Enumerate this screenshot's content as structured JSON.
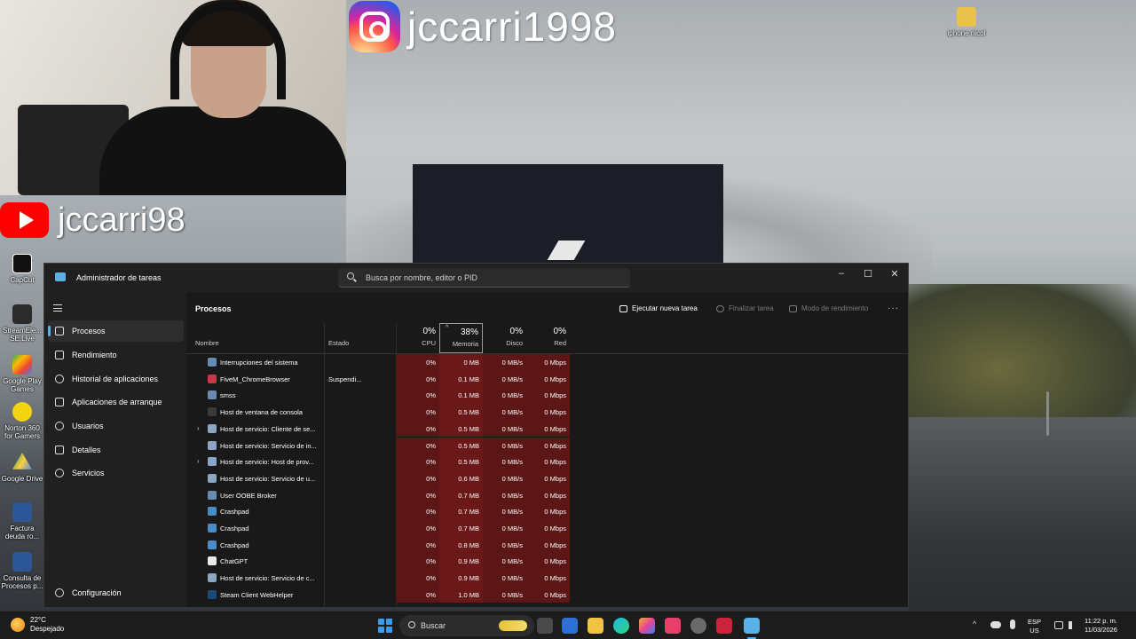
{
  "overlay": {
    "instagram_handle": "jccarri1998",
    "youtube_handle": "jccarri98"
  },
  "desktop_icons": [
    {
      "label": "iphone nicol",
      "name": "desktop-icon-iphone-nicol"
    },
    {
      "label": "CapCut",
      "name": "desktop-icon-capcut"
    },
    {
      "label": "StreamEle... SE.Live",
      "name": "desktop-icon-streamelements"
    },
    {
      "label": "Google Play Games",
      "name": "desktop-icon-google-play-games"
    },
    {
      "label": "Norton 360 for Gamers",
      "name": "desktop-icon-norton"
    },
    {
      "label": "Google Drive",
      "name": "desktop-icon-google-drive"
    },
    {
      "label": "Factura deuda ro...",
      "name": "desktop-icon-factura"
    },
    {
      "label": "Consulta de Procesos p...",
      "name": "desktop-icon-consulta"
    }
  ],
  "window": {
    "title": "Administrador de tareas",
    "search_placeholder": "Busca por nombre, editor o PID",
    "minimize": "–",
    "maximize": "☐",
    "close": "✕"
  },
  "sidebar": {
    "items": [
      {
        "label": "Procesos",
        "active": true
      },
      {
        "label": "Rendimiento"
      },
      {
        "label": "Historial de aplicaciones"
      },
      {
        "label": "Aplicaciones de arranque"
      },
      {
        "label": "Usuarios"
      },
      {
        "label": "Detalles"
      },
      {
        "label": "Servicios"
      }
    ],
    "settings_label": "Configuración"
  },
  "main": {
    "title": "Procesos",
    "commands": {
      "new_task": "Ejecutar nueva tarea",
      "end_task": "Finalizar tarea",
      "efficiency": "Modo de rendimiento",
      "more": "···"
    },
    "columns": {
      "name": "Nombre",
      "status": "Estado",
      "cpu_pct": "0%",
      "cpu_label": "CPU",
      "mem_pct": "38%",
      "mem_label": "Memoria",
      "disk_pct": "0%",
      "disk_label": "Disco",
      "net_pct": "0%",
      "net_label": "Red",
      "sort_indicator": "^"
    },
    "processes": [
      {
        "name": "Interrupciones del sistema",
        "status": "",
        "cpu": "0%",
        "mem": "0 MB",
        "disk": "0 MB/s",
        "net": "0 Mbps",
        "expand": false,
        "icon": "system-icon",
        "color": "#6a8bb0"
      },
      {
        "name": "FiveM_ChromeBrowser",
        "status": "Suspendi...",
        "cpu": "0%",
        "mem": "0.1 MB",
        "disk": "0 MB/s",
        "net": "0 Mbps",
        "expand": false,
        "icon": "fivem-icon",
        "color": "#d0334a"
      },
      {
        "name": "smss",
        "status": "",
        "cpu": "0%",
        "mem": "0.1 MB",
        "disk": "0 MB/s",
        "net": "0 Mbps",
        "expand": false,
        "icon": "system-icon",
        "color": "#6a8bb0"
      },
      {
        "name": "Host de ventana de consola",
        "status": "",
        "cpu": "0%",
        "mem": "0.5 MB",
        "disk": "0 MB/s",
        "net": "0 Mbps",
        "expand": false,
        "icon": "console-icon",
        "color": "#3a3a3a"
      },
      {
        "name": "Host de servicio: Cliente de se...",
        "status": "",
        "cpu": "0%",
        "mem": "0.5 MB",
        "disk": "0 MB/s",
        "net": "0 Mbps",
        "expand": true,
        "icon": "service-icon",
        "color": "#8ba6c4"
      },
      {
        "name": "Host de servicio: Servicio de in...",
        "status": "",
        "cpu": "0%",
        "mem": "0.5 MB",
        "disk": "0 MB/s",
        "net": "0 Mbps",
        "expand": false,
        "icon": "service-icon",
        "color": "#8ba6c4"
      },
      {
        "name": "Host de servicio: Host de prov...",
        "status": "",
        "cpu": "0%",
        "mem": "0.5 MB",
        "disk": "0 MB/s",
        "net": "0 Mbps",
        "expand": true,
        "icon": "service-icon",
        "color": "#8ba6c4"
      },
      {
        "name": "Host de servicio: Servicio de u...",
        "status": "",
        "cpu": "0%",
        "mem": "0.6 MB",
        "disk": "0 MB/s",
        "net": "0 Mbps",
        "expand": false,
        "icon": "service-icon",
        "color": "#8ba6c4"
      },
      {
        "name": "User OOBE Broker",
        "status": "",
        "cpu": "0%",
        "mem": "0.7 MB",
        "disk": "0 MB/s",
        "net": "0 Mbps",
        "expand": false,
        "icon": "system-icon",
        "color": "#6a8bb0"
      },
      {
        "name": "Crashpad",
        "status": "",
        "cpu": "0%",
        "mem": "0.7 MB",
        "disk": "0 MB/s",
        "net": "0 Mbps",
        "expand": false,
        "icon": "crashpad-icon",
        "color": "#4a8cc7"
      },
      {
        "name": "Crashpad",
        "status": "",
        "cpu": "0%",
        "mem": "0.7 MB",
        "disk": "0 MB/s",
        "net": "0 Mbps",
        "expand": false,
        "icon": "crashpad-icon",
        "color": "#4a8cc7"
      },
      {
        "name": "Crashpad",
        "status": "",
        "cpu": "0%",
        "mem": "0.8 MB",
        "disk": "0 MB/s",
        "net": "0 Mbps",
        "expand": false,
        "icon": "crashpad-icon",
        "color": "#4a8cc7"
      },
      {
        "name": "ChatGPT",
        "status": "",
        "cpu": "0%",
        "mem": "0.9 MB",
        "disk": "0 MB/s",
        "net": "0 Mbps",
        "expand": false,
        "icon": "chatgpt-icon",
        "color": "#e8e8e8"
      },
      {
        "name": "Host de servicio: Servicio de c...",
        "status": "",
        "cpu": "0%",
        "mem": "0.9 MB",
        "disk": "0 MB/s",
        "net": "0 Mbps",
        "expand": false,
        "icon": "service-icon",
        "color": "#8ba6c4"
      },
      {
        "name": "Steam Client WebHelper",
        "status": "",
        "cpu": "0%",
        "mem": "1.0 MB",
        "disk": "0 MB/s",
        "net": "0 Mbps",
        "expand": false,
        "icon": "steam-icon",
        "color": "#1b4a7a"
      }
    ]
  },
  "taskbar": {
    "weather_temp": "22°C",
    "weather_desc": "Despejado",
    "search_label": "Buscar",
    "lang_top": "ESP",
    "lang_bottom": "US",
    "time": "11:22 p. m.",
    "date": "11/03/2026",
    "tray_chevron": "^"
  }
}
